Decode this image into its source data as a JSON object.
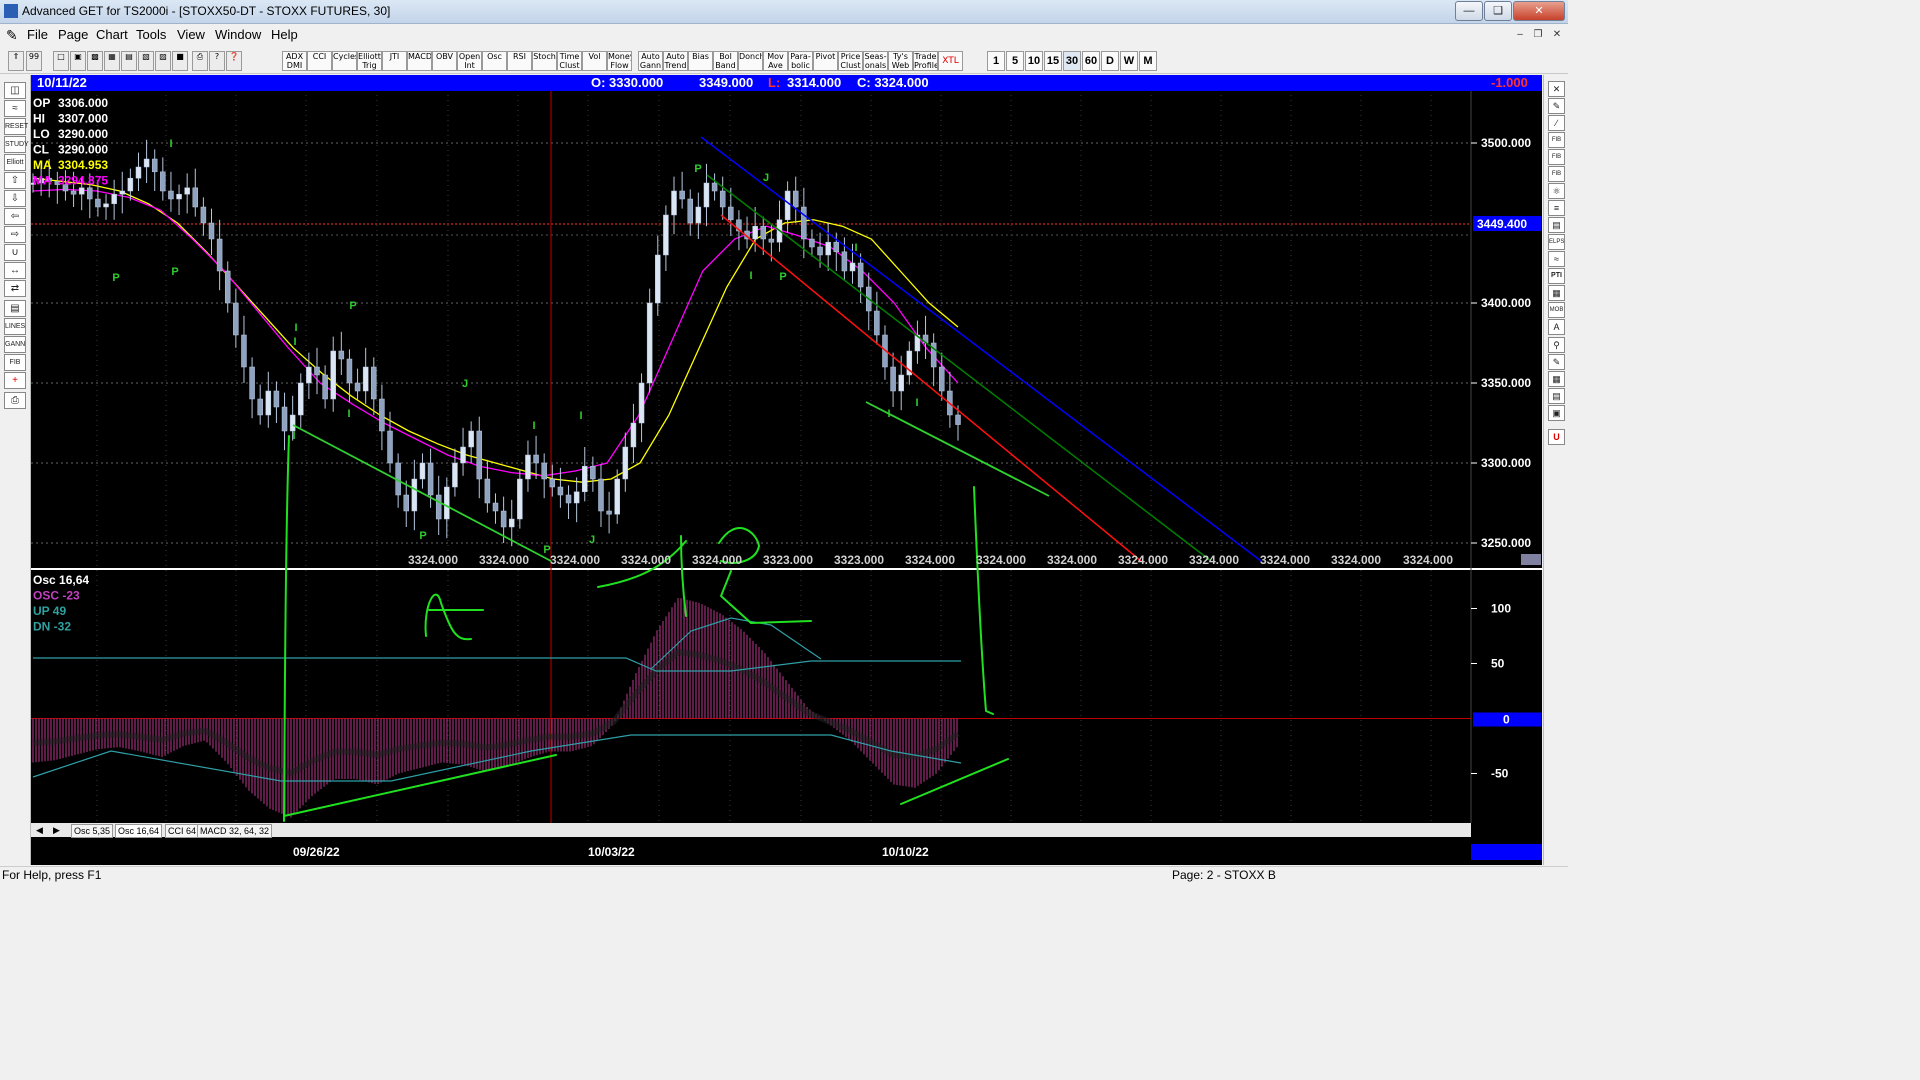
{
  "window": {
    "title": "Advanced GET for TS2000i - [STOXX50-DT - STOXX FUTURES, 30]"
  },
  "menu": [
    "File",
    "Page",
    "Chart",
    "Tools",
    "View",
    "Window",
    "Help"
  ],
  "toolbar": {
    "studies": [
      "ADX DMI",
      "CCI",
      "Cycles",
      "Elliott Trig",
      "JTI",
      "MACD",
      "OBV",
      "Open Int",
      "Osc",
      "RSI",
      "Stoch",
      "Time Clust",
      "Vol",
      "Money Flow",
      "Auto Gann",
      "Auto Trend",
      "Bias",
      "Bol Band",
      "Donch",
      "Mov Ave",
      "Para-bolic",
      "Pivot",
      "Price Clust",
      "Seas-onals",
      "Ty's Web",
      "Trade Profile",
      "XTL"
    ],
    "periods": [
      "1",
      "5",
      "10",
      "15",
      "30",
      "60",
      "D",
      "W",
      "M"
    ]
  },
  "info": {
    "date": "10/11/22",
    "open": "O: 3330.000",
    "high": "3349.000",
    "low_label": "L:",
    "low": "3314.000",
    "close": "C: 3324.000",
    "change": "-1.000"
  },
  "price_panel": {
    "legend": [
      {
        "label": "OP",
        "value": "3306.000",
        "color": "#ffffff"
      },
      {
        "label": "HI",
        "value": "3307.000",
        "color": "#ffffff"
      },
      {
        "label": "LO",
        "value": "3290.000",
        "color": "#ffffff"
      },
      {
        "label": "CL",
        "value": "3290.000",
        "color": "#ffffff"
      },
      {
        "label": "MA",
        "value": "3304.953",
        "color": "#ffff00"
      },
      {
        "label": "MA",
        "value": "3294.875",
        "color": "#ff00ff"
      }
    ],
    "y_ticks": [
      "3500.000",
      "3400.000",
      "3350.000",
      "3300.000",
      "3250.000"
    ],
    "current_price_tag": "3449.400",
    "bottom_labels": [
      "3324.000",
      "3324.000",
      "3324.000",
      "3324.000",
      "3324.000",
      "3323.000",
      "3323.000",
      "3324.000",
      "3324.000",
      "3324.000",
      "3324.000",
      "3324.000",
      "3324.000",
      "3324.000",
      "3324.000"
    ],
    "pivot_labels": [
      "P",
      "I",
      "P",
      "I",
      "I",
      "P",
      "I",
      "J",
      "P",
      "P",
      "I",
      "J",
      "P",
      "J",
      "P",
      "I",
      "I",
      "I",
      "I",
      "I",
      "I"
    ]
  },
  "osc_panel": {
    "legend": [
      {
        "text": "Osc 16,64",
        "color": "#ffffff"
      },
      {
        "text": "OSC -23",
        "color": "#c040c0"
      },
      {
        "text": "UP   49",
        "color": "#30a0a0"
      },
      {
        "text": "DN   -32",
        "color": "#30a0a0"
      }
    ],
    "y_ticks": [
      "100",
      "50",
      "0",
      "-50"
    ],
    "zero_tag": "0"
  },
  "tabs": [
    "Osc 5,35",
    "Osc 16,64",
    "CCI 64",
    "MACD 32, 64, 32"
  ],
  "dates": [
    "09/26/22",
    "10/03/22",
    "10/10/22"
  ],
  "status": {
    "help": "For Help, press F1",
    "page": "Page: 2 - STOXX B"
  },
  "chart_data": {
    "type": "candlestick",
    "ylim": [
      3235,
      3530
    ],
    "series": [
      {
        "name": "price",
        "values": [
          3475,
          3478,
          3476,
          3474,
          3470,
          3468,
          3472,
          3465,
          3460,
          3462,
          3468,
          3470,
          3478,
          3485,
          3490,
          3482,
          3470,
          3465,
          3468,
          3472,
          3460,
          3450,
          3440,
          3420,
          3400,
          3380,
          3360,
          3340,
          3330,
          3345,
          3335,
          3320,
          3330,
          3350,
          3360,
          3355,
          3340,
          3370,
          3365,
          3350,
          3345,
          3360,
          3340,
          3320,
          3300,
          3280,
          3270,
          3290,
          3300,
          3280,
          3265,
          3285,
          3300,
          3310,
          3320,
          3290,
          3275,
          3270,
          3260,
          3265,
          3290,
          3305,
          3300,
          3290,
          3285,
          3280,
          3275,
          3282,
          3298,
          3290,
          3270,
          3268,
          3290,
          3310,
          3325,
          3350,
          3400,
          3430,
          3455,
          3470,
          3465,
          3450,
          3460,
          3475,
          3470,
          3460,
          3452,
          3445,
          3440,
          3448,
          3440,
          3438,
          3452,
          3470,
          3460,
          3440,
          3435,
          3430,
          3438,
          3432,
          3420,
          3425,
          3410,
          3395,
          3380,
          3360,
          3345,
          3355,
          3370,
          3380,
          3375,
          3360,
          3345,
          3330,
          3324
        ]
      },
      {
        "name": "MA",
        "values": [
          3478,
          3476,
          3474,
          3470,
          3462,
          3450,
          3432,
          3412,
          3392,
          3372,
          3356,
          3342,
          3330,
          3320,
          3312,
          3305,
          3300,
          3295,
          3290,
          3288,
          3290,
          3300,
          3330,
          3370,
          3410,
          3440,
          3450,
          3452,
          3448,
          3440,
          3420,
          3400,
          3385
        ]
      },
      {
        "name": "MA",
        "values": [
          3470,
          3471,
          3470,
          3466,
          3458,
          3440,
          3420,
          3396,
          3372,
          3350,
          3337,
          3325,
          3315,
          3305,
          3298,
          3294,
          3292,
          3295,
          3300,
          3330,
          3375,
          3420,
          3440,
          3448,
          3442,
          3435,
          3420,
          3400,
          3372,
          3350
        ]
      }
    ],
    "oscillator": {
      "name": "Osc 16,64",
      "values": [
        -40,
        -38,
        -33,
        -28,
        -26,
        -30,
        -35,
        -25,
        -20,
        -40,
        -65,
        -82,
        -90,
        -70,
        -55,
        -55,
        -60,
        -50,
        -45,
        -40,
        -42,
        -48,
        -44,
        -36,
        -30,
        -30,
        -25,
        -5,
        40,
        80,
        110,
        105,
        95,
        80,
        60,
        35,
        10,
        -5,
        -20,
        -40,
        -60,
        -63,
        -50,
        -25
      ]
    }
  }
}
